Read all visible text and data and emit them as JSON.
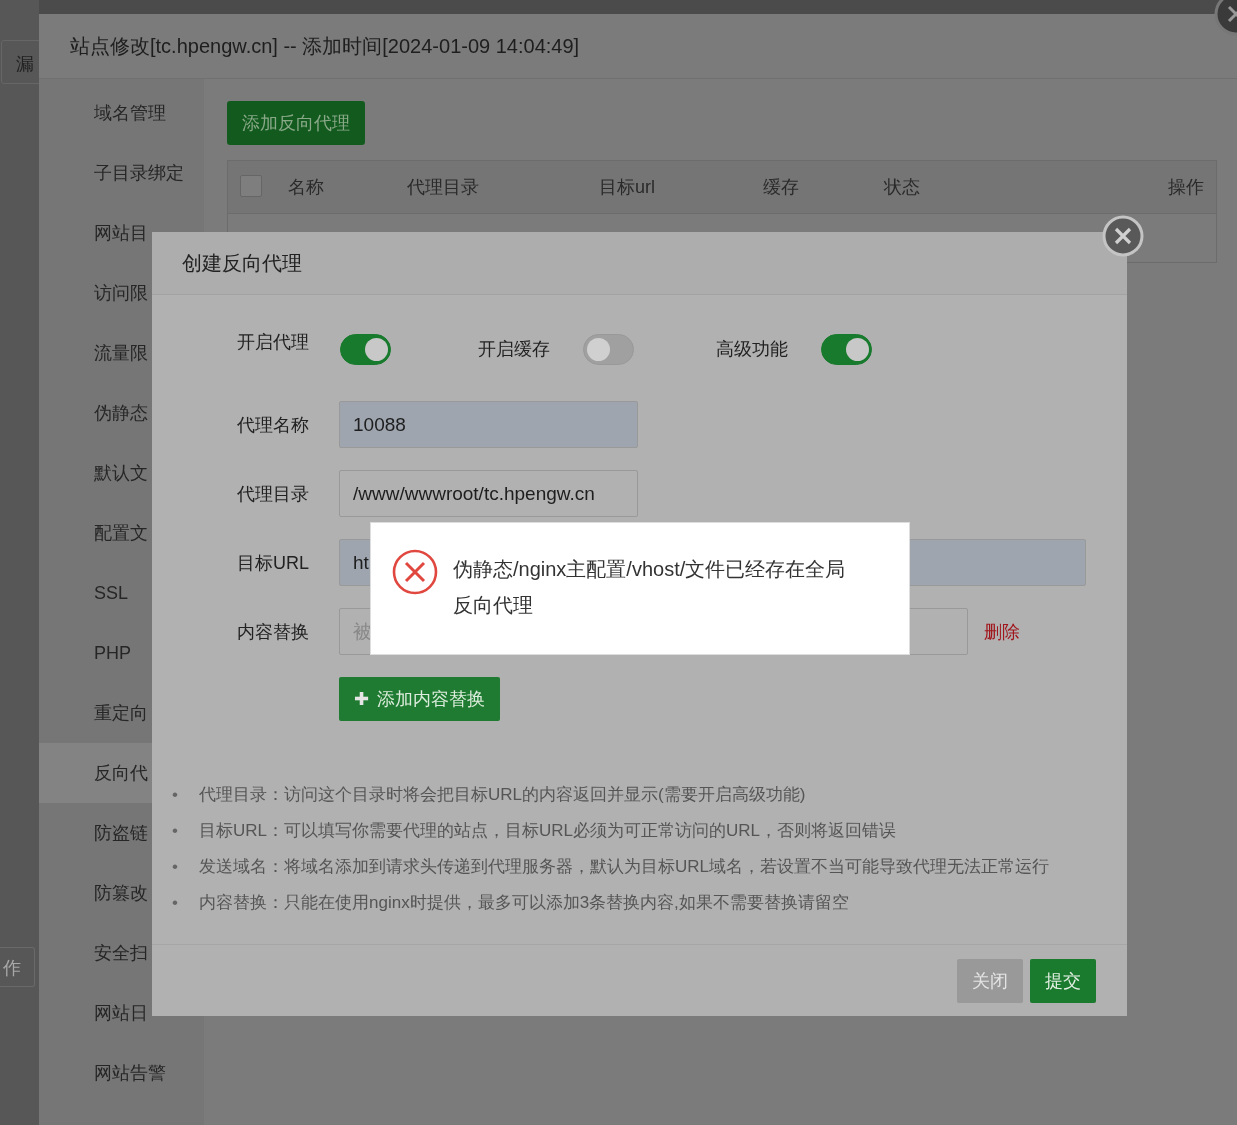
{
  "background": {
    "button_text": "漏",
    "cell_text": "作"
  },
  "site_dialog": {
    "title": "站点修改[tc.hpengw.cn] -- 添加时间[2024-01-09 14:04:49]",
    "sidebar": {
      "items": [
        {
          "label": "域名管理",
          "selected": false
        },
        {
          "label": "子目录绑定",
          "selected": false
        },
        {
          "label": "网站目",
          "selected": false
        },
        {
          "label": "访问限",
          "selected": false
        },
        {
          "label": "流量限",
          "selected": false
        },
        {
          "label": "伪静态",
          "selected": false
        },
        {
          "label": "默认文",
          "selected": false
        },
        {
          "label": "配置文",
          "selected": false
        },
        {
          "label": "SSL",
          "selected": false
        },
        {
          "label": "PHP",
          "selected": false
        },
        {
          "label": "重定向",
          "selected": false
        },
        {
          "label": "反向代",
          "selected": true
        },
        {
          "label": "防盗链",
          "selected": false
        },
        {
          "label": "防篡改",
          "selected": false
        },
        {
          "label": "安全扫",
          "selected": false
        },
        {
          "label": "网站日",
          "selected": false
        },
        {
          "label": "网站告警",
          "selected": false
        }
      ]
    },
    "add_button": "添加反向代理",
    "table": {
      "select_all_checked": false,
      "columns": [
        "名称",
        "代理目录",
        "目标url",
        "缓存",
        "状态",
        "操作"
      ]
    }
  },
  "proxy_dialog": {
    "title": "创建反向代理",
    "toggles": [
      {
        "label": "开启代理",
        "on": true
      },
      {
        "label": "开启缓存",
        "on": false
      },
      {
        "label": "高级功能",
        "on": true
      }
    ],
    "fields": [
      {
        "label": "代理名称",
        "value": "10088",
        "disabled": true
      },
      {
        "label": "代理目录",
        "value": "/www/wwwroot/tc.hpengw.cn",
        "disabled": false
      },
      {
        "label": "目标URL",
        "value": "ht",
        "disabled": true
      }
    ],
    "replace": {
      "label": "内容替换",
      "placeholder": "被",
      "delete": "删除"
    },
    "add_replace_button": {
      "icon": "✚",
      "label": "添加内容替换"
    },
    "notes": [
      {
        "bullet": "•",
        "text": "代理目录：访问这个目录时将会把目标URL的内容返回并显示(需要开启高级功能)"
      },
      {
        "bullet": "•",
        "text": "目标URL：可以填写你需要代理的站点，目标URL必须为可正常访问的URL，否则将返回错误"
      },
      {
        "bullet": "•",
        "text": "发送域名：将域名添加到请求头传递到代理服务器，默认为目标URL域名，若设置不当可能导致代理无法正常运行"
      },
      {
        "bullet": "•",
        "text": "内容替换：只能在使用nginx时提供，最多可以添加3条替换内容,如果不需要替换请留空"
      }
    ],
    "buttons": [
      {
        "label": "关闭",
        "kind": "secondary"
      },
      {
        "label": "提交",
        "kind": "primary"
      }
    ]
  },
  "toast": {
    "kind": "error",
    "message": "伪静态/nginx主配置/vhost/文件已经存在全局反向代理"
  }
}
